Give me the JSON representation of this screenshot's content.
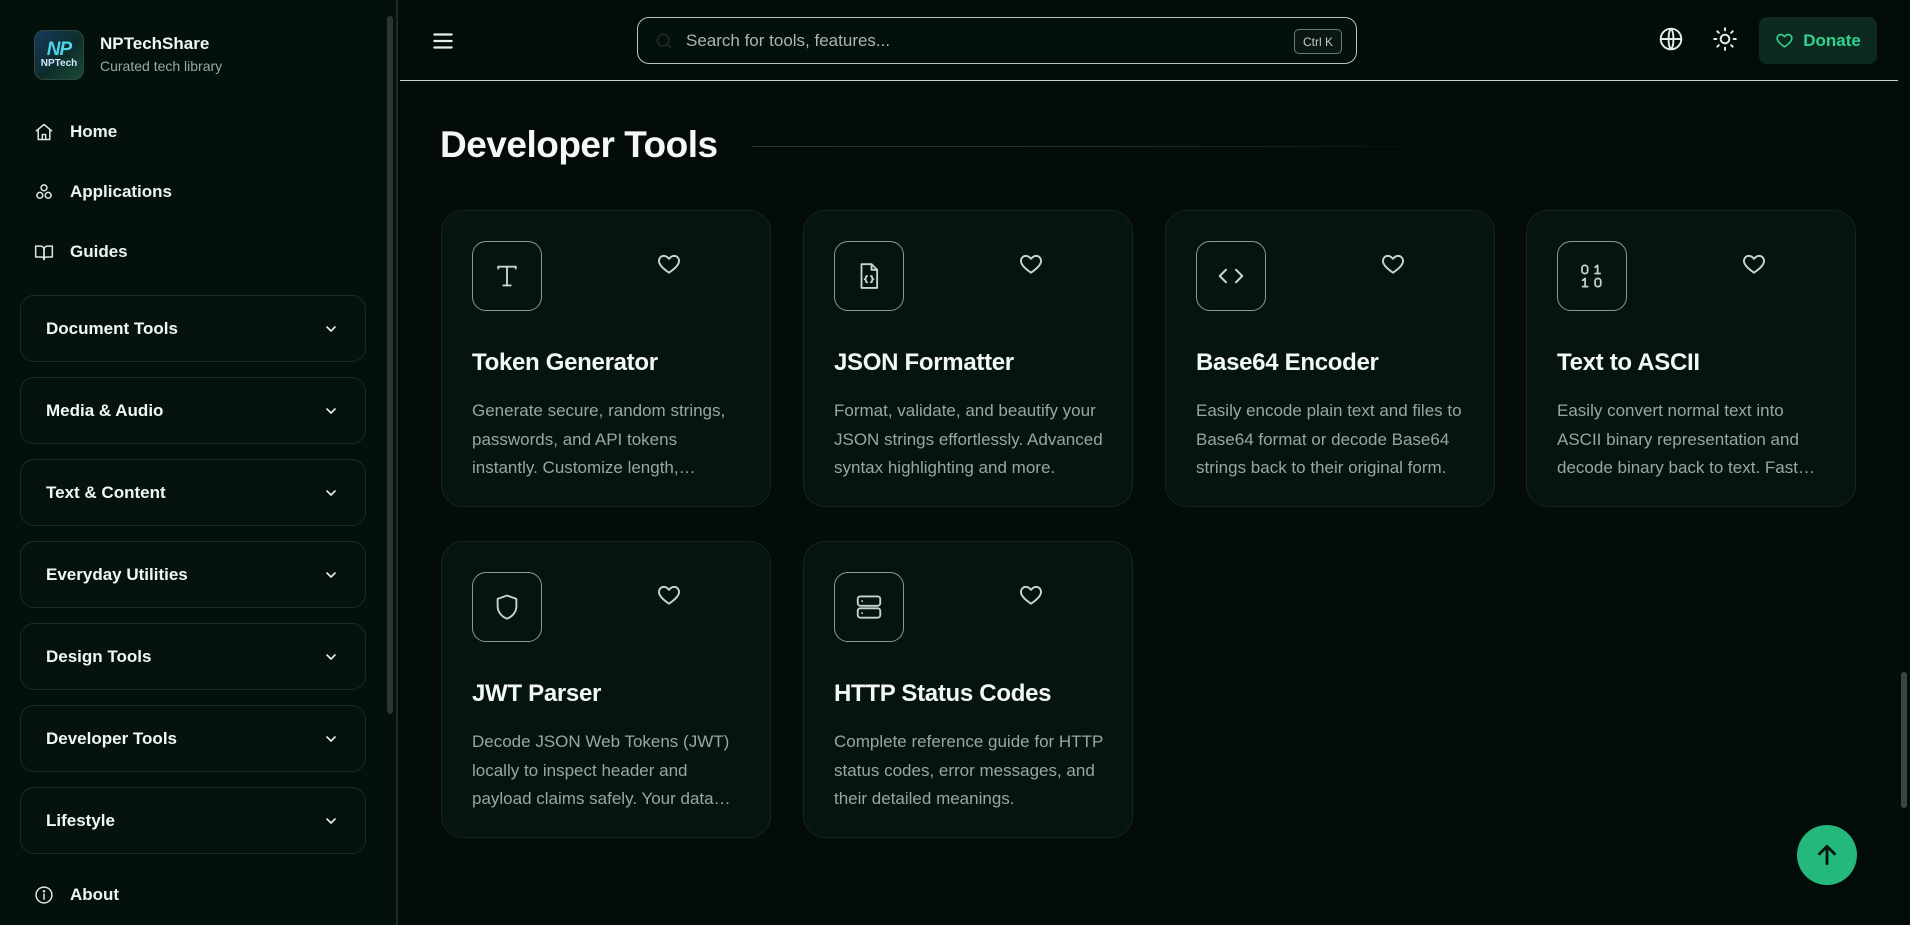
{
  "brand": {
    "name": "NPTechShare",
    "subtitle": "Curated tech library",
    "logo_line1": "NP",
    "logo_line2": "NPTech"
  },
  "nav": {
    "home": "Home",
    "applications": "Applications",
    "guides": "Guides",
    "about": "About"
  },
  "groups": [
    {
      "label": "Document Tools"
    },
    {
      "label": "Media & Audio"
    },
    {
      "label": "Text & Content"
    },
    {
      "label": "Everyday Utilities"
    },
    {
      "label": "Design Tools"
    },
    {
      "label": "Developer Tools"
    },
    {
      "label": "Lifestyle"
    }
  ],
  "header": {
    "search_placeholder": "Search for tools, features...",
    "shortcut": "Ctrl K",
    "donate_label": "Donate"
  },
  "section": {
    "title": "Developer Tools"
  },
  "cards": [
    {
      "title": "Token Generator",
      "icon": "text-type-icon",
      "description": "Generate secure, random strings, passwords, and API tokens instantly. Customize length, characters and more."
    },
    {
      "title": "JSON Formatter",
      "icon": "file-json-icon",
      "description": "Format, validate, and beautify your JSON strings effortlessly. Advanced syntax highlighting and more."
    },
    {
      "title": "Base64 Encoder",
      "icon": "code-icon",
      "description": "Easily encode plain text and files to Base64 format or decode Base64 strings back to their original form."
    },
    {
      "title": "Text to ASCII",
      "icon": "binary-icon",
      "description": "Easily convert normal text into ASCII binary representation and decode binary back to text. Fast and free."
    },
    {
      "title": "JWT Parser",
      "icon": "shield-icon",
      "description": "Decode JSON Web Tokens (JWT) locally to inspect header and payload claims safely. Your data stays private."
    },
    {
      "title": "HTTP Status Codes",
      "icon": "server-icon",
      "description": "Complete reference guide for HTTP status codes, error messages, and their detailed meanings."
    }
  ],
  "colors": {
    "accent": "#25b87d",
    "donate_text": "#33d28f",
    "background": "#030c09"
  }
}
